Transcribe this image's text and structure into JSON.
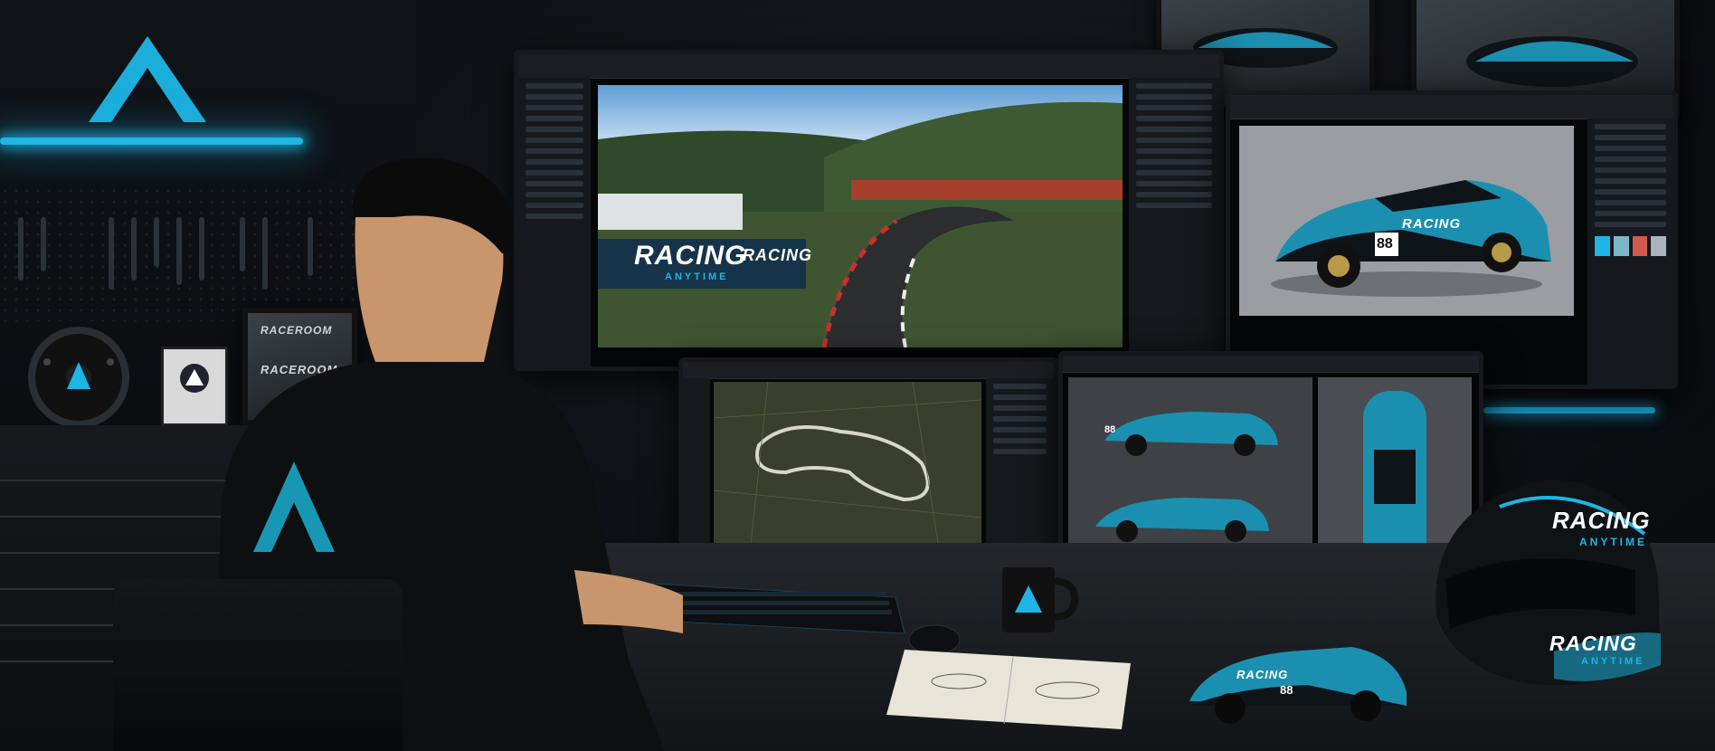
{
  "scene": {
    "description_tags": [
      "sim-racing design studio",
      "multi-monitor workstation"
    ],
    "colors": {
      "accent": "#1db6e6",
      "dark": "#0b0e12",
      "livery": "#1b8fb0"
    }
  },
  "signage": {
    "track_banner_main": "RACING",
    "track_banner_sub": "ANYTIME",
    "track_banner_repeat": "RACING",
    "poster_brand": "RACEROOM",
    "poster_brand_2": "RACEROOM"
  },
  "livery": {
    "main_car_text": "RACING",
    "main_car_number": "88",
    "side_car_number": "88",
    "model_car_text": "RACING",
    "model_car_number": "88"
  },
  "helmet": {
    "top_text": "RACING",
    "top_sub": "ANYTIME",
    "side_text": "RACING",
    "side_sub": "ANYTIME"
  },
  "icons": [
    "apex-logo-icon",
    "steering-wheel-icon",
    "keyboard-icon",
    "mouse-icon",
    "mug-icon",
    "notebook-icon",
    "helmet-icon"
  ]
}
